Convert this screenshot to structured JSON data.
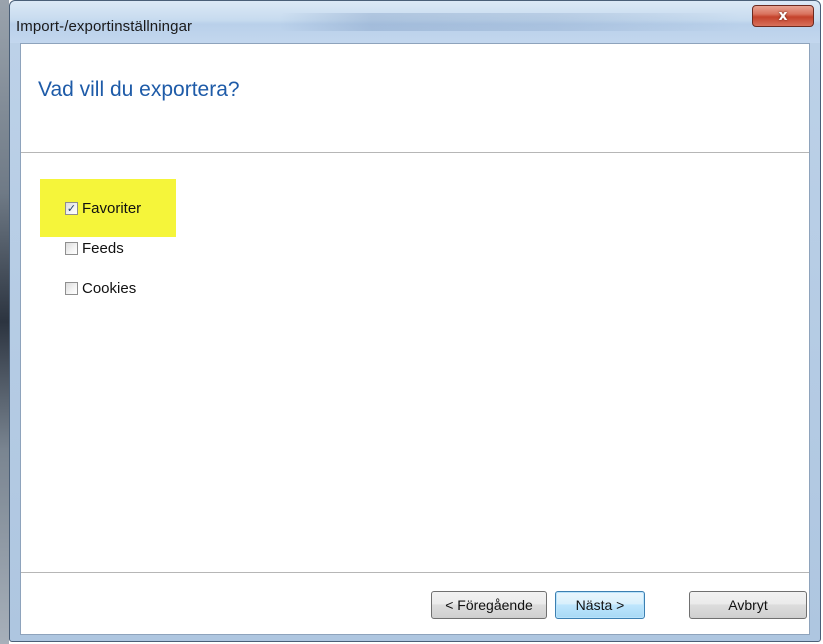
{
  "window": {
    "title": "Import-/exportinställningar",
    "close_glyph": "x"
  },
  "header": {
    "question": "Vad vill du exportera?"
  },
  "options": [
    {
      "label": "Favoriter",
      "checked": true,
      "highlighted": true
    },
    {
      "label": "Feeds",
      "checked": false
    },
    {
      "label": "Cookies",
      "checked": false
    }
  ],
  "footer": {
    "back_label": "< Föregående",
    "next_label": "Nästa >",
    "cancel_label": "Avbryt"
  },
  "colors": {
    "title_blue": "#1e5ba8",
    "highlight_yellow": "#f5f53a",
    "close_red": "#c4422b"
  },
  "icons": {
    "check": "✓"
  }
}
